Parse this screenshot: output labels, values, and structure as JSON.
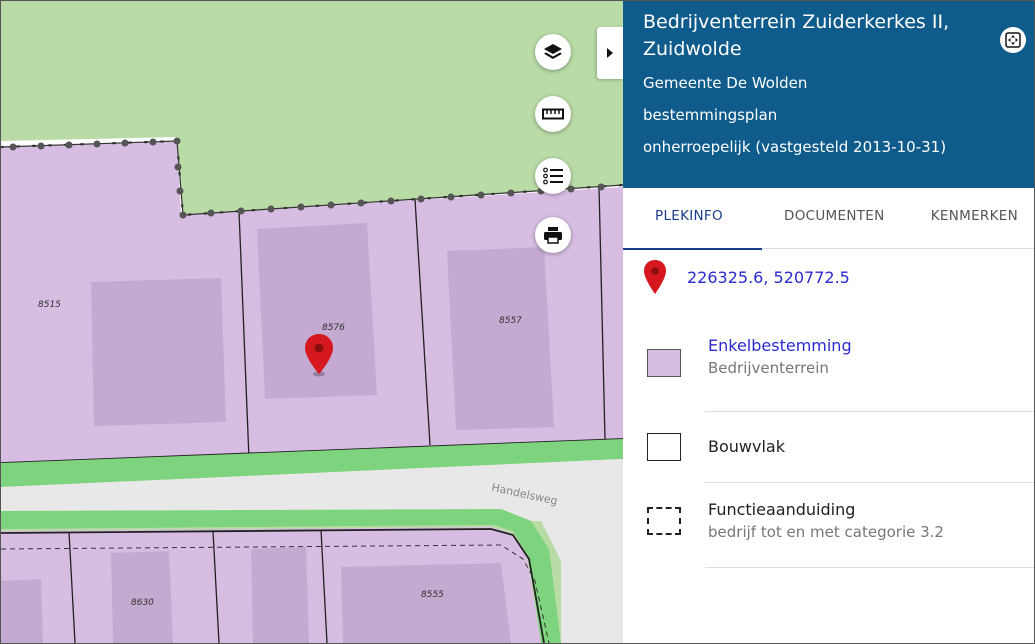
{
  "panel": {
    "title": "Bedrijventerrein Zuiderkerkes II, Zuidwolde",
    "municipality": "Gemeente De Wolden",
    "plan_type": "bestemmingsplan",
    "status": "onherroepelijk (vastgesteld 2013-10-31)",
    "colors": {
      "header_bg": "#0f5c8c",
      "header_text": "#ffffff",
      "link": "#2a2ad2",
      "active_tab": "#1a3d8c"
    }
  },
  "tabs": [
    {
      "label": "PLEKINFO",
      "active": true
    },
    {
      "label": "DOCUMENTEN",
      "active": false
    },
    {
      "label": "KENMERKEN",
      "active": false
    }
  ],
  "location": {
    "coordinates": "226325.6, 520772.5",
    "icon": "map-marker-icon"
  },
  "legend": [
    {
      "title": "Enkelbestemming",
      "subtitle": "Bedrijventerrein",
      "swatch": "purple-fill",
      "color": "#d7bde2",
      "link": true
    },
    {
      "title": "Bouwvlak",
      "subtitle": "",
      "swatch": "solid-outline",
      "link": false
    },
    {
      "title": "Functieaanduiding",
      "subtitle": "bedrijf tot en met categorie 3.2",
      "swatch": "dashed-outline",
      "link": false
    }
  ],
  "map": {
    "parcel_labels": [
      "8515",
      "8576",
      "8557",
      "8630",
      "8555"
    ],
    "street_label": "Handelsweg",
    "controls": [
      {
        "name": "layers-button",
        "icon": "layers-icon"
      },
      {
        "name": "measure-button",
        "icon": "ruler-icon"
      },
      {
        "name": "legend-button",
        "icon": "list-icon"
      },
      {
        "name": "print-button",
        "icon": "printer-icon"
      }
    ],
    "colors": {
      "parcel": "#d7bde2",
      "building": "#c4a9d1",
      "green": "#b9dba6",
      "road": "#e8e8e8",
      "verge": "#7ed37e"
    }
  }
}
